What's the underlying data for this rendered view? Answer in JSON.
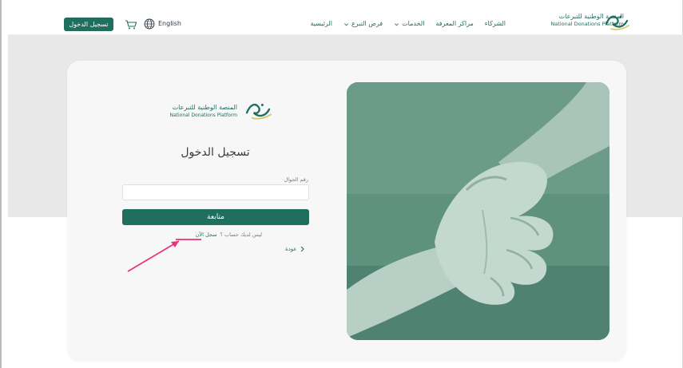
{
  "header": {
    "login_label": "تسجيل الدخول",
    "language_label": "English",
    "brand_ar": "المنصة الوطنية للتبرعات",
    "brand_en": "National Donations Platform",
    "nav": {
      "home": "الرئيسية",
      "opportunities": "فرص التبرع",
      "services": "الخدمات",
      "knowledge": "مراكز المعرفة",
      "partners": "الشركاء"
    }
  },
  "form": {
    "brand_ar": "المنصة الوطنية للتبرعات",
    "brand_en": "National Donations Platform",
    "title": "تسجيل الدخول",
    "phone_label": "رقم الجوال",
    "phone_value": "",
    "continue_label": "متابعة",
    "no_account_text": "ليس لديك حساب ؟",
    "register_link": "سجل الآن",
    "back_label": "عودة"
  },
  "colors": {
    "brand": "#1f6e5e",
    "band": "#e8e8e8",
    "card": "#f7f7f7",
    "annotation": "#e8327a"
  },
  "icons": [
    "cart-icon",
    "globe-icon",
    "chevron-down-icon",
    "chevron-right-icon",
    "logo-icon",
    "hands-photo"
  ]
}
